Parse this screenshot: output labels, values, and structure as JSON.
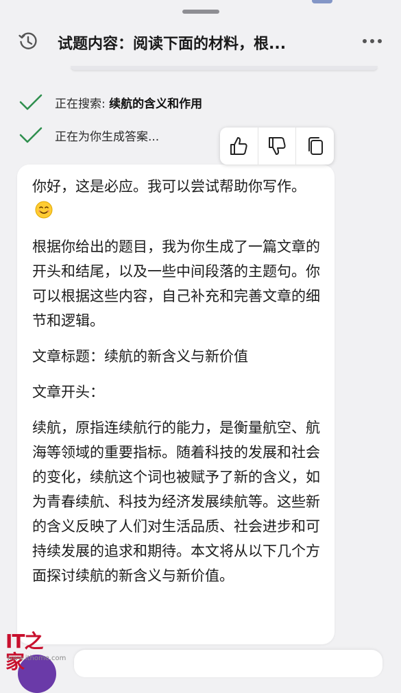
{
  "header": {
    "title": "试题内容：阅读下面的材料，根...",
    "history_icon": "history-clock-icon",
    "more_icon": "more-horizontal-icon"
  },
  "status": {
    "searching_prefix": "正在搜索: ",
    "searching_query": "续航的含义和作用",
    "generating": "正在为你生成答案..."
  },
  "feedback": {
    "like_icon": "thumbs-up-icon",
    "dislike_icon": "thumbs-down-icon",
    "copy_icon": "copy-icon"
  },
  "answer": {
    "greeting": "你好，这是必应。我可以尝试帮助你写作。",
    "intro": "根据你给出的题目，我为你生成了一篇文章的开头和结尾，以及一些中间段落的主题句。你可以根据这些内容，自己补充和完善文章的细节和逻辑。",
    "title_line": "文章标题：续航的新含义与新价值",
    "opening_label": "文章开头：",
    "opening_text": "续航，原指连续航行的能力，是衡量航空、航海等领域的重要指标。随着科技的发展和社会的变化，续航这个词也被赋予了新的含义，如为青春续航、科技为经济发展续航等。这些新的含义反映了人们对生活品质、社会进步和可持续发展的追求和期待。本文将从以下几个方面探讨续航的新含义与新价值。"
  },
  "watermark": {
    "brand": "IT之家",
    "url": "www.ithome.com"
  },
  "colors": {
    "check_green": "#2f8f4e",
    "card_bg": "#ffffff",
    "sheet_bg": "#f1f1f3",
    "brand_red": "#c8102e"
  }
}
